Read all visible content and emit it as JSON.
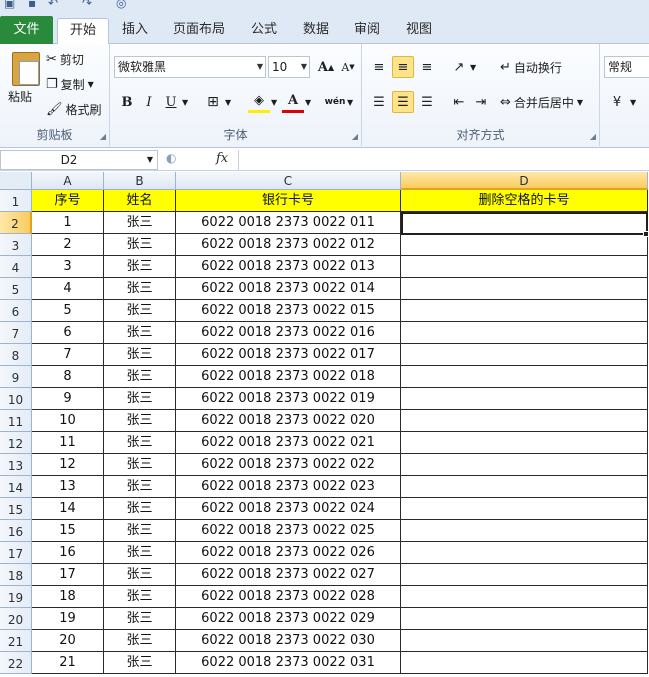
{
  "tabs": {
    "file": "文件",
    "items": [
      "开始",
      "插入",
      "页面布局",
      "公式",
      "数据",
      "审阅",
      "视图"
    ],
    "active_index": 0
  },
  "ribbon": {
    "clipboard": {
      "label": "剪贴板",
      "paste": "粘贴",
      "cut": "剪切",
      "copy": "复制",
      "format_painter": "格式刷"
    },
    "font": {
      "label": "字体",
      "font_name": "微软雅黑",
      "font_size": "10",
      "bold": "B",
      "italic": "I",
      "underline": "U",
      "grow": "A",
      "shrink": "A",
      "font_color": "A",
      "phonetic": "wén"
    },
    "alignment": {
      "label": "对齐方式",
      "wrap_text": "自动换行",
      "merge_center": "合并后居中"
    },
    "number": {
      "format": "常规"
    }
  },
  "formula_bar": {
    "name_box": "D2",
    "fx": "fx",
    "value": ""
  },
  "sheet": {
    "columns": [
      "A",
      "B",
      "C",
      "D"
    ],
    "active_column": "D",
    "active_row": 2,
    "header_row": [
      "序号",
      "姓名",
      "银行卡号",
      "删除空格的卡号"
    ],
    "rows": [
      [
        "1",
        "张三",
        "6022 0018 2373 0022 011",
        ""
      ],
      [
        "2",
        "张三",
        "6022 0018 2373 0022 012",
        ""
      ],
      [
        "3",
        "张三",
        "6022 0018 2373 0022 013",
        ""
      ],
      [
        "4",
        "张三",
        "6022 0018 2373 0022 014",
        ""
      ],
      [
        "5",
        "张三",
        "6022 0018 2373 0022 015",
        ""
      ],
      [
        "6",
        "张三",
        "6022 0018 2373 0022 016",
        ""
      ],
      [
        "7",
        "张三",
        "6022 0018 2373 0022 017",
        ""
      ],
      [
        "8",
        "张三",
        "6022 0018 2373 0022 018",
        ""
      ],
      [
        "9",
        "张三",
        "6022 0018 2373 0022 019",
        ""
      ],
      [
        "10",
        "张三",
        "6022 0018 2373 0022 020",
        ""
      ],
      [
        "11",
        "张三",
        "6022 0018 2373 0022 021",
        ""
      ],
      [
        "12",
        "张三",
        "6022 0018 2373 0022 022",
        ""
      ],
      [
        "13",
        "张三",
        "6022 0018 2373 0022 023",
        ""
      ],
      [
        "14",
        "张三",
        "6022 0018 2373 0022 024",
        ""
      ],
      [
        "15",
        "张三",
        "6022 0018 2373 0022 025",
        ""
      ],
      [
        "16",
        "张三",
        "6022 0018 2373 0022 026",
        ""
      ],
      [
        "17",
        "张三",
        "6022 0018 2373 0022 027",
        ""
      ],
      [
        "18",
        "张三",
        "6022 0018 2373 0022 028",
        ""
      ],
      [
        "19",
        "张三",
        "6022 0018 2373 0022 029",
        ""
      ],
      [
        "20",
        "张三",
        "6022 0018 2373 0022 030",
        ""
      ],
      [
        "21",
        "张三",
        "6022 0018 2373 0022 031",
        ""
      ]
    ]
  },
  "colors": {
    "header_fill": "#ffff00",
    "file_tab": "#2a8a3c",
    "active_header": "#f9cc5e"
  }
}
